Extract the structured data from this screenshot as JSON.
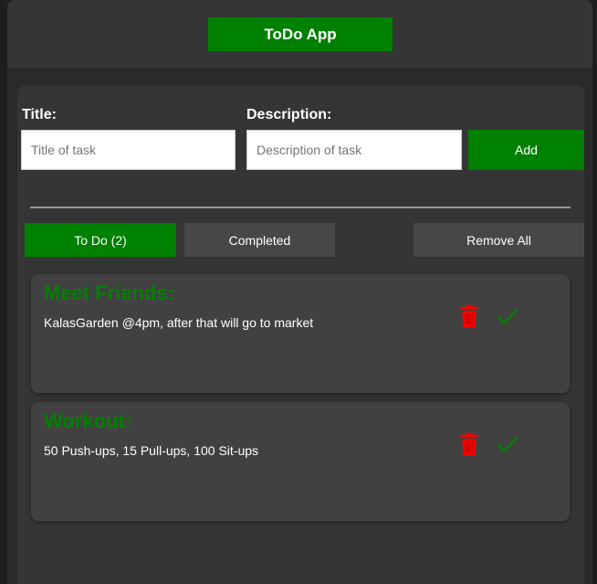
{
  "header": {
    "title": "ToDo App"
  },
  "form": {
    "title_label": "Title:",
    "title_placeholder": "Title of task",
    "title_value": "",
    "description_label": "Description:",
    "description_placeholder": "Description of task",
    "description_value": "",
    "add_label": "Add"
  },
  "tabs": {
    "todo_label": "To Do (2)",
    "completed_label": "Completed",
    "remove_all_label": "Remove All",
    "active": "todo"
  },
  "tasks": [
    {
      "title": "Meet Friends:",
      "description": "KalasGarden @4pm, after that will go to market"
    },
    {
      "title": "Workout:",
      "description": "50 Push-ups, 15 Pull-ups, 100 Sit-ups"
    }
  ],
  "icons": {
    "delete": "trash-icon",
    "complete": "check-icon"
  },
  "colors": {
    "accent": "#008000",
    "delete": "#ff0000",
    "background": "#2a2a2a",
    "panel": "#353535",
    "card": "#414141"
  }
}
